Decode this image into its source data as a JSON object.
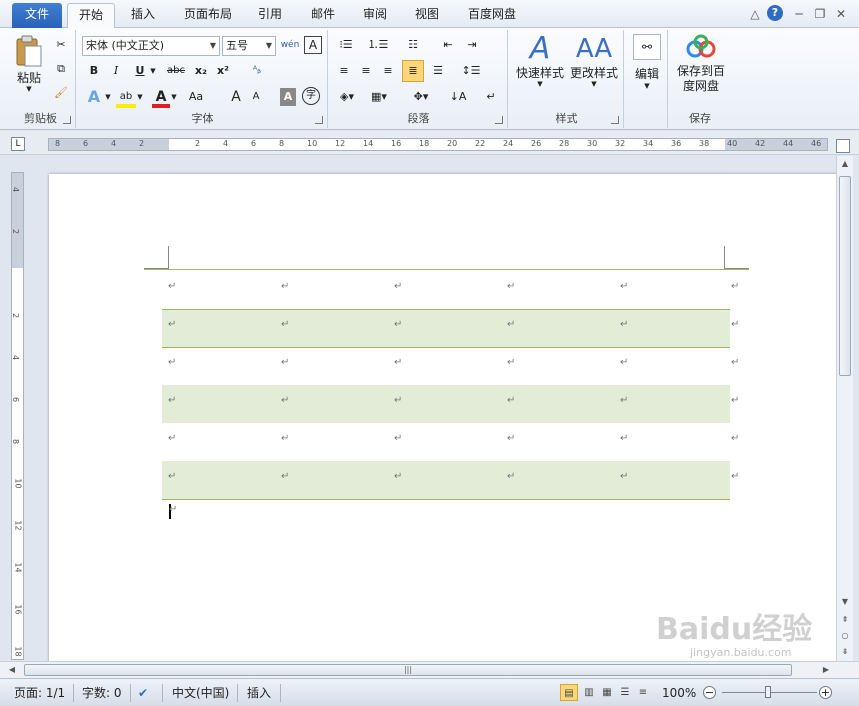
{
  "tabs": {
    "file": "文件",
    "items": [
      "开始",
      "插入",
      "页面布局",
      "引用",
      "邮件",
      "审阅",
      "视图",
      "百度网盘"
    ],
    "active": "开始"
  },
  "window_controls": {
    "minimize": "─",
    "restore": "❐",
    "close": "✕",
    "ribbon_toggle": "△",
    "help": "?"
  },
  "ribbon": {
    "clipboard": {
      "label": "剪贴板",
      "paste": "粘贴"
    },
    "font": {
      "label": "字体",
      "font_name": "宋体 (中文正文)",
      "font_size": "五号",
      "bold": "B",
      "italic": "I",
      "underline": "U",
      "strike": "abc",
      "subscript": "x₂",
      "superscript": "x²",
      "change_case": "Aa",
      "grow": "A",
      "shrink": "A",
      "wen": "wén"
    },
    "paragraph": {
      "label": "段落"
    },
    "styles": {
      "label": "样式",
      "quick_styles": "快速样式",
      "change_styles": "更改样式"
    },
    "editing": {
      "label": "编辑",
      "edit": "编辑"
    },
    "save": {
      "label": "保存",
      "save_baidu_line1": "保存到百",
      "save_baidu_line2": "度网盘"
    }
  },
  "ruler": {
    "ticks": [
      "8",
      "6",
      "4",
      "2",
      "",
      "2",
      "4",
      "6",
      "8",
      "10",
      "12",
      "14",
      "16",
      "18",
      "20",
      "22",
      "24",
      "26",
      "28",
      "30",
      "32",
      "34",
      "36",
      "38",
      "40",
      "42",
      "44",
      "46"
    ],
    "vticks": [
      "4",
      "2",
      "",
      "2",
      "4",
      "6",
      "8",
      "10",
      "12",
      "14",
      "16",
      "18"
    ]
  },
  "document": {
    "cell_mark": "↵",
    "rows": 6,
    "cols": 5
  },
  "status": {
    "page": "页面: 1/1",
    "words": "字数: 0",
    "language": "中文(中国)",
    "mode": "插入",
    "zoom": "100%"
  },
  "watermark": {
    "text": "Baidu经验",
    "sub": "jingyan.baidu.com"
  }
}
